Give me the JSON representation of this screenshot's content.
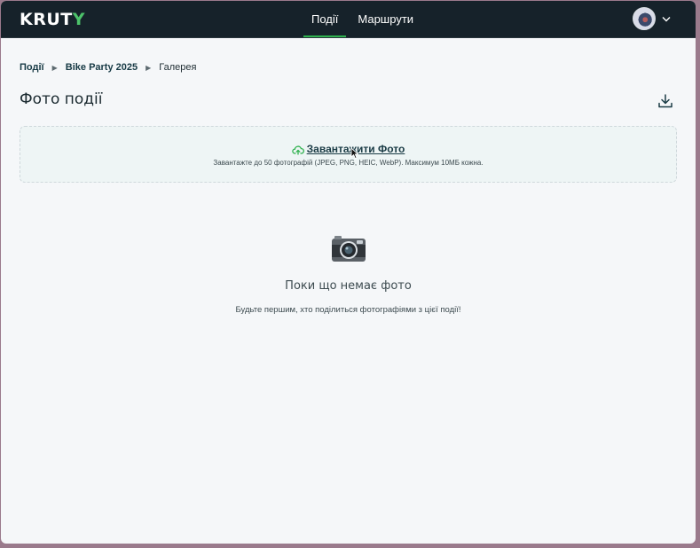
{
  "header": {
    "logo": "KRUTY",
    "nav": [
      {
        "label": "Події",
        "active": true
      },
      {
        "label": "Маршрути",
        "active": false
      }
    ],
    "accent_color": "#2fb14e"
  },
  "breadcrumb": {
    "items": [
      "Події",
      "Bike Party 2025",
      "Галерея"
    ]
  },
  "page": {
    "title": "Фото події"
  },
  "upload": {
    "button_label": "Завантажити Фото",
    "hint": "Завантажте до 50 фотографій (JPEG, PNG, HEIC, WebP). Максимум 10МБ кожна."
  },
  "empty_state": {
    "icon": "camera-icon",
    "title": "Поки що немає фото",
    "subtitle": "Будьте першим, хто поділиться фотографіями з цієї події!"
  }
}
